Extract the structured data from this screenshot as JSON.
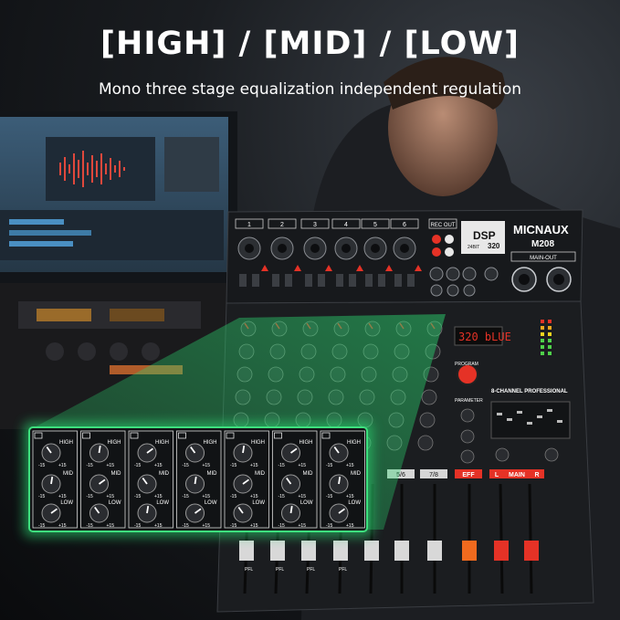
{
  "headline": "[HIGH] / [MID] / [LOW]",
  "subline": "Mono three stage equalization independent regulation",
  "mixer": {
    "brand": "MICNAUX",
    "model": "M208",
    "channel_numbers": [
      "1",
      "2",
      "3",
      "4",
      "5",
      "6"
    ],
    "rec_out_label": "REC OUT",
    "main_out_label": "MAIN-OUT",
    "dsp_label": "DSP",
    "dsp_bits": "24BIT",
    "dsp_number": "320",
    "display_text": "320 bLUE",
    "program_label": "PROGRAM",
    "parameter_label": "PARAMETER",
    "eq_title": "8-CHANNEL PROFESSIONAL",
    "fader_labels": [
      "5/6",
      "7/8",
      "EFF",
      "L",
      "MAIN",
      "R"
    ],
    "pfl_label": "PFL"
  },
  "eq_panel": {
    "band_labels": [
      "HIGH",
      "MID",
      "LOW"
    ],
    "scale_min": "-15",
    "scale_max": "+15",
    "channel_count_label": "7"
  },
  "colors": {
    "beam": "#2bd46f",
    "mixer_body": "#1b1d20",
    "accent_red": "#e53226",
    "accent_orange": "#f06a1e"
  }
}
